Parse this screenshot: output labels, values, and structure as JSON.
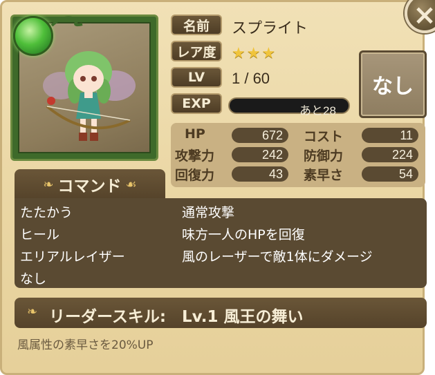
{
  "close_label": "×",
  "labels": {
    "name": "名前",
    "rarity": "レア度",
    "level": "LV",
    "exp": "EXP"
  },
  "monster": {
    "name": "スプライト",
    "rarity_stars": "★★★",
    "level": "1 / 60",
    "exp_remaining": "あと28",
    "exp_progress": 0.0
  },
  "equip_button": "なし",
  "stats": {
    "hp_label": "HP",
    "hp": "672",
    "cost_label": "コスト",
    "cost": "11",
    "attack_label": "攻撃力",
    "attack": "242",
    "defense_label": "防御力",
    "defense": "224",
    "recovery_label": "回復力",
    "recovery": "43",
    "speed_label": "素早さ",
    "speed": "54"
  },
  "command_header": "コマンド",
  "commands": [
    {
      "name": "たたかう",
      "desc": "通常攻撃"
    },
    {
      "name": "ヒール",
      "desc": "味方一人のHPを回復"
    },
    {
      "name": "エリアルレイザー",
      "desc": "風のレーザーで敵1体にダメージ"
    },
    {
      "name": "なし",
      "desc": ""
    }
  ],
  "leader_skill": {
    "label": "リーダースキル:",
    "name": "Lv.1 風王の舞い",
    "desc": "風属性の素早さを20%UP"
  },
  "colors": {
    "panel_bg": "#ead6a3",
    "dark_brown": "#55432a",
    "element_green": "#4fbf3a",
    "star_gold": "#f0c43c"
  }
}
